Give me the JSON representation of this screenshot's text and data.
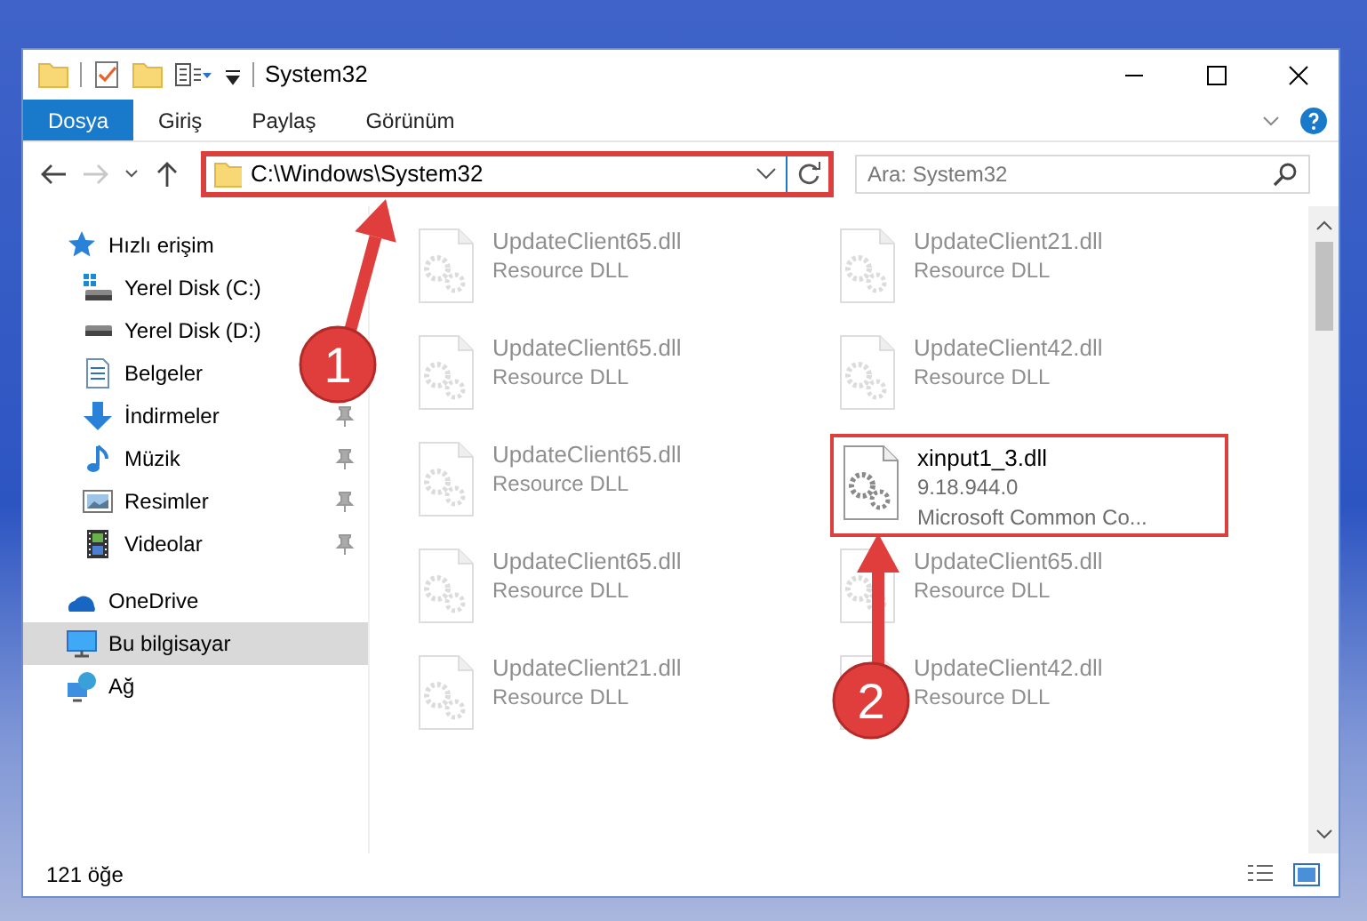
{
  "window": {
    "title": "System32"
  },
  "ribbon_tabs": [
    {
      "label": "Dosya",
      "selected": true
    },
    {
      "label": "Giriş",
      "selected": false
    },
    {
      "label": "Paylaş",
      "selected": false
    },
    {
      "label": "Görünüm",
      "selected": false
    }
  ],
  "address": {
    "path": "C:\\Windows\\System32",
    "highlighted": true
  },
  "search": {
    "placeholder": "Ara: System32"
  },
  "sidebar": {
    "items": [
      {
        "label": "Hızlı erişim",
        "kind": "star",
        "selected": false,
        "pinned": false,
        "children": [
          {
            "label": "Yerel Disk (C:)",
            "kind": "drive-windows",
            "selected": false,
            "pinned": false
          },
          {
            "label": "Yerel Disk (D:)",
            "kind": "drive",
            "selected": false,
            "pinned": false
          },
          {
            "label": "Belgeler",
            "kind": "documents",
            "selected": false,
            "pinned": false
          },
          {
            "label": "İndirmeler",
            "kind": "download",
            "selected": false,
            "pinned": true
          },
          {
            "label": "Müzik",
            "kind": "music",
            "selected": false,
            "pinned": true
          },
          {
            "label": "Resimler",
            "kind": "pictures",
            "selected": false,
            "pinned": true
          },
          {
            "label": "Videolar",
            "kind": "videos",
            "selected": false,
            "pinned": true
          }
        ]
      },
      {
        "label": "OneDrive",
        "kind": "cloud",
        "selected": false,
        "pinned": false
      },
      {
        "label": "Bu bilgisayar",
        "kind": "computer",
        "selected": true,
        "pinned": false
      },
      {
        "label": "Ağ",
        "kind": "network",
        "selected": false,
        "pinned": false
      }
    ]
  },
  "files": [
    {
      "name": "UpdateClient65.dll",
      "lines": [
        "Resource DLL"
      ],
      "blurred": true,
      "highlighted": false
    },
    {
      "name": "UpdateClient21.dll",
      "lines": [
        "Resource DLL"
      ],
      "blurred": true,
      "highlighted": false
    },
    {
      "name": "UpdateClient65.dll",
      "lines": [
        "Resource DLL"
      ],
      "blurred": true,
      "highlighted": false
    },
    {
      "name": "UpdateClient42.dll",
      "lines": [
        "Resource DLL"
      ],
      "blurred": true,
      "highlighted": false
    },
    {
      "name": "UpdateClient65.dll",
      "lines": [
        "Resource DLL"
      ],
      "blurred": true,
      "highlighted": false
    },
    {
      "name": "xinput1_3.dll",
      "lines": [
        "9.18.944.0",
        "Microsoft Common Co..."
      ],
      "blurred": false,
      "highlighted": true
    },
    {
      "name": "UpdateClient65.dll",
      "lines": [
        "Resource DLL"
      ],
      "blurred": true,
      "highlighted": false
    },
    {
      "name": "UpdateClient65.dll",
      "lines": [
        "Resource DLL"
      ],
      "blurred": true,
      "highlighted": false
    },
    {
      "name": "UpdateClient21.dll",
      "lines": [
        "Resource DLL"
      ],
      "blurred": true,
      "highlighted": false
    },
    {
      "name": "UpdateClient42.dll",
      "lines": [
        "Resource DLL"
      ],
      "blurred": true,
      "highlighted": false
    }
  ],
  "status_bar": {
    "count": "121 öğe"
  },
  "annotations": [
    {
      "label": "1"
    },
    {
      "label": "2"
    }
  ]
}
